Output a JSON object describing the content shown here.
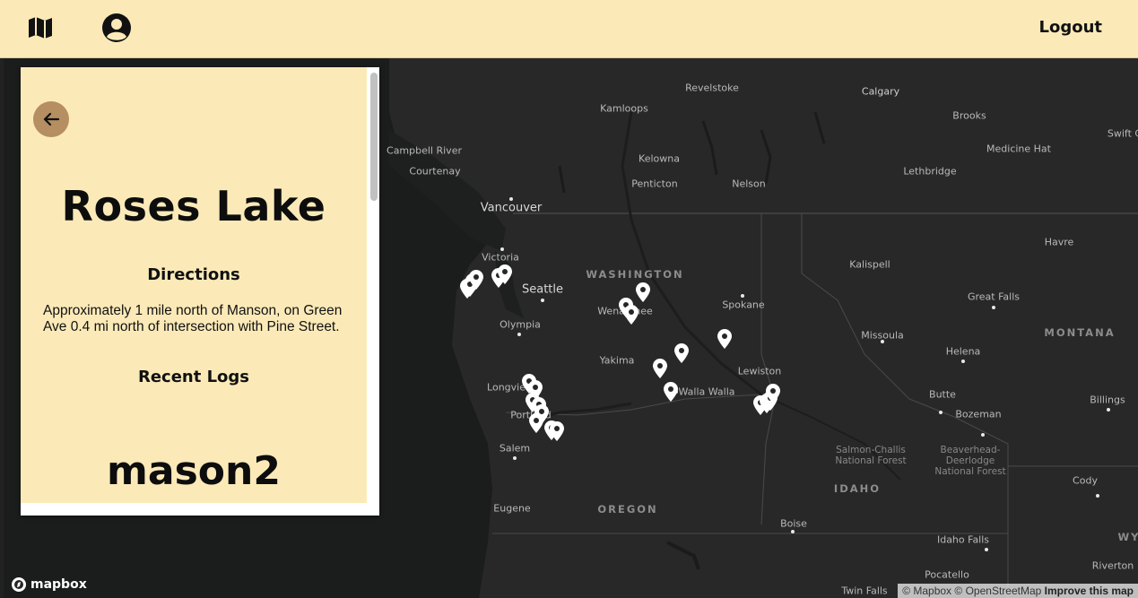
{
  "header": {
    "logout_label": "Logout",
    "map_icon": "map-icon",
    "profile_icon": "user-circle-icon"
  },
  "panel": {
    "title": "Roses Lake",
    "directions_heading": "Directions",
    "directions_text": "Approximately 1 mile north of Manson, on Green Ave 0.4 mi north of intersection with Pine Street.",
    "recent_logs_heading": "Recent Logs",
    "log_user": "mason2",
    "back_icon": "arrow-left-icon"
  },
  "map": {
    "labels": {
      "revelstoke": "Revelstoke",
      "calgary": "Calgary",
      "kamloops": "Kamloops",
      "brooks": "Brooks",
      "swift": "Swift C",
      "campbell_river": "Campbell River",
      "courtenay": "Courtenay",
      "kelowna": "Kelowna",
      "medicine_hat": "Medicine Hat",
      "penticton": "Penticton",
      "nelson": "Nelson",
      "lethbridge": "Lethbridge",
      "vancouver": "Vancouver",
      "havre": "Havre",
      "victoria": "Victoria",
      "kalispell": "Kalispell",
      "washington": "WASHINGTON",
      "seattle": "Seattle",
      "great_falls": "Great Falls",
      "wenatchee": "Wenatchee",
      "spokane": "Spokane",
      "olympia": "Olympia",
      "missoula": "Missoula",
      "montana": "MONTANA",
      "helena": "Helena",
      "yakima": "Yakima",
      "lewiston": "Lewiston",
      "longview": "Longview",
      "walla_walla": "Walla Walla",
      "butte": "Butte",
      "billings": "Billings",
      "portland": "Portland",
      "bozeman": "Bozeman",
      "salem": "Salem",
      "salmon_challis": "Salmon-Challis\nNational Forest",
      "beaverhead": "Beaverhead-\nDeerlodge\nNational Forest",
      "idaho": "IDAHO",
      "cody": "Cody",
      "eugene": "Eugene",
      "oregon": "OREGON",
      "boise": "Boise",
      "idaho_falls": "Idaho Falls",
      "wy": "WY",
      "riverton": "Riverton",
      "pocatello": "Pocatello",
      "twin_falls": "Twin Falls"
    },
    "attribution": {
      "mapbox": "© Mapbox",
      "osm": "© OpenStreetMap",
      "improve": "Improve this map"
    },
    "logo_text": "mapbox",
    "pin_icon": "map-pin-icon"
  }
}
